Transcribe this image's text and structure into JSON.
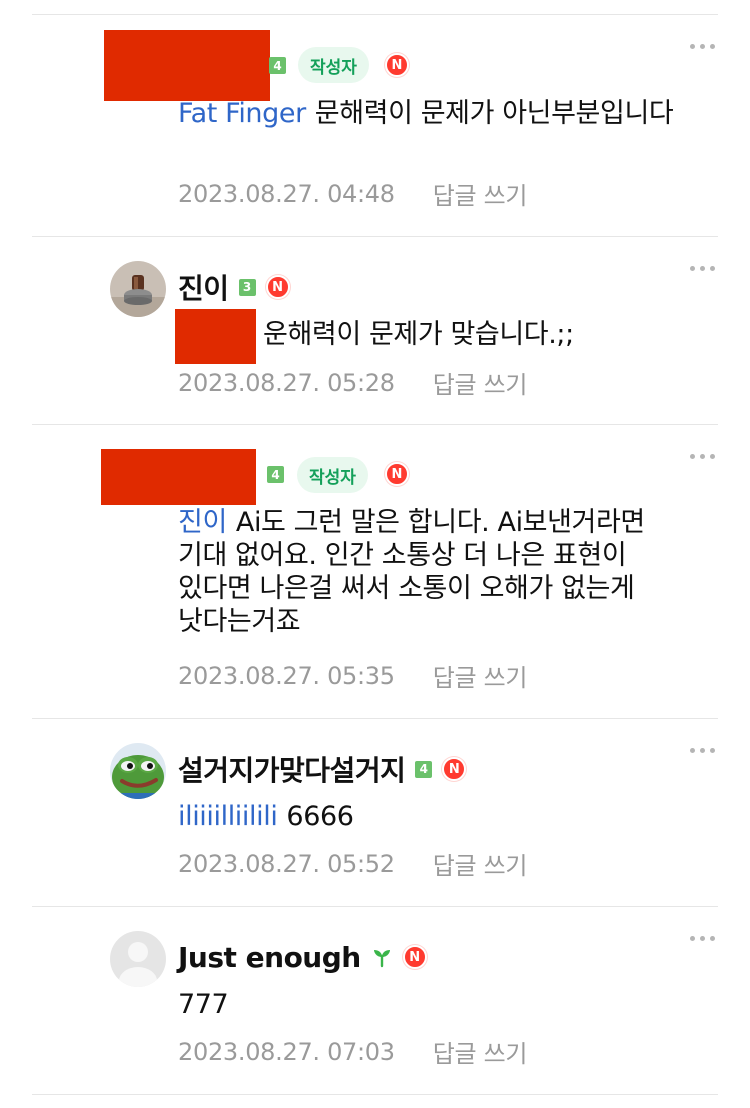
{
  "badges": {
    "author_label": "작성자",
    "new_label": "N",
    "reply_label": "답글 쓰기"
  },
  "colors": {
    "mention": "#2f66c8",
    "author_badge_bg": "#e8f8ee",
    "author_badge_text": "#14a05a",
    "new_badge": "#ff3a2f",
    "level_badge": "#6bc16b",
    "redaction": "#e02a00"
  },
  "comments": [
    {
      "author": "",
      "level": "4",
      "is_writer": true,
      "is_new": true,
      "mention": "Fat Finger",
      "text": "문해력이 문제가 아닌부분입니다",
      "time": "2023.08.27. 04:48",
      "avatar_icon": "redacted"
    },
    {
      "author": "진이",
      "level": "3",
      "is_writer": false,
      "is_new": true,
      "mention": "",
      "text": "운해력이 문제가 맞습니다.;;",
      "time": "2023.08.27. 05:28",
      "avatar_icon": "tamper-photo-avatar"
    },
    {
      "author": "",
      "level": "4",
      "is_writer": true,
      "is_new": true,
      "mention": "진이",
      "text": "Ai도 그런 말은 합니다. Ai보낸거라면 기대 없어요. 인간 소통상 더 나은 표현이 있다면 나은걸 써서 소통이 오해가 없는게 낫다는거죠",
      "time": "2023.08.27. 05:35",
      "avatar_icon": "redacted"
    },
    {
      "author": "설거지가맞다설거지",
      "level": "4",
      "is_writer": false,
      "is_new": true,
      "mention": "iliiiilliilili",
      "text": "6666",
      "time": "2023.08.27. 05:52",
      "avatar_icon": "pepe-frog-avatar"
    },
    {
      "author": "Just enough",
      "level": "sprout",
      "is_writer": false,
      "is_new": true,
      "mention": "",
      "text": "777",
      "time": "2023.08.27. 07:03",
      "avatar_icon": "default-person-avatar"
    }
  ]
}
